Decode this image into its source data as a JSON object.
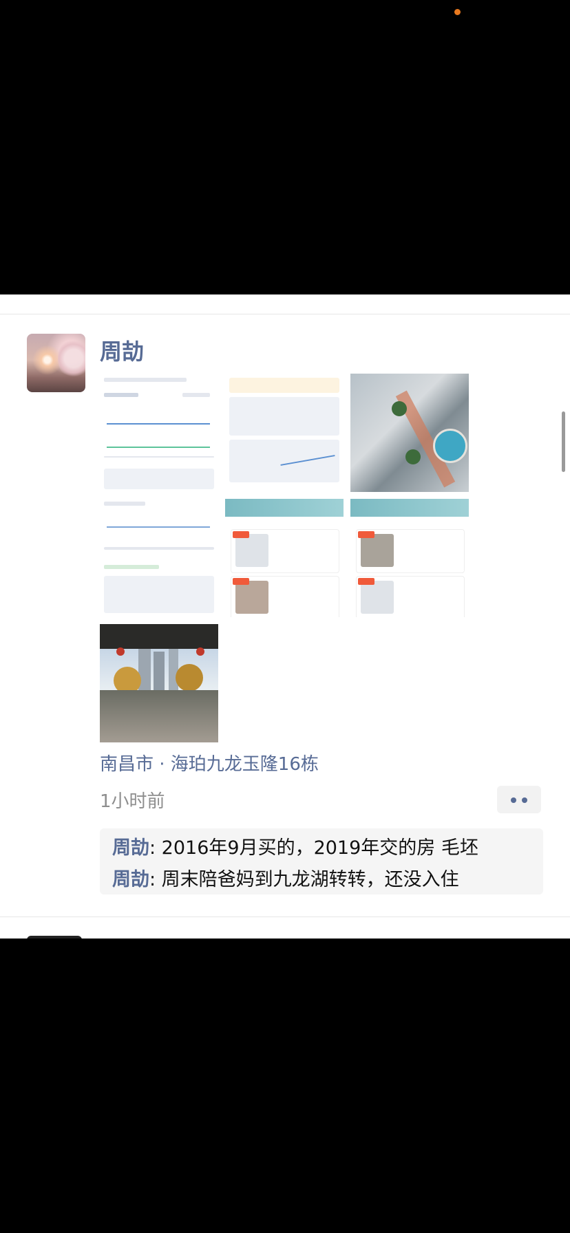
{
  "post": {
    "username": "周劼",
    "location": "南昌市 · 海珀九龙玉隆16栋",
    "time": "1小时前",
    "comments": [
      {
        "author": "周劼",
        "text": ": 2016年9月买的，2019年交的房 毛坯"
      },
      {
        "author": "周劼",
        "text": ": 周末陪爸妈到九龙湖转转，还没入住"
      }
    ],
    "image_count": 7
  },
  "icons": {
    "more": "more-dots-icon"
  },
  "colors": {
    "name_blue": "#576b95",
    "time_gray": "#8e8e8e",
    "comment_bg": "#f5f5f5"
  }
}
